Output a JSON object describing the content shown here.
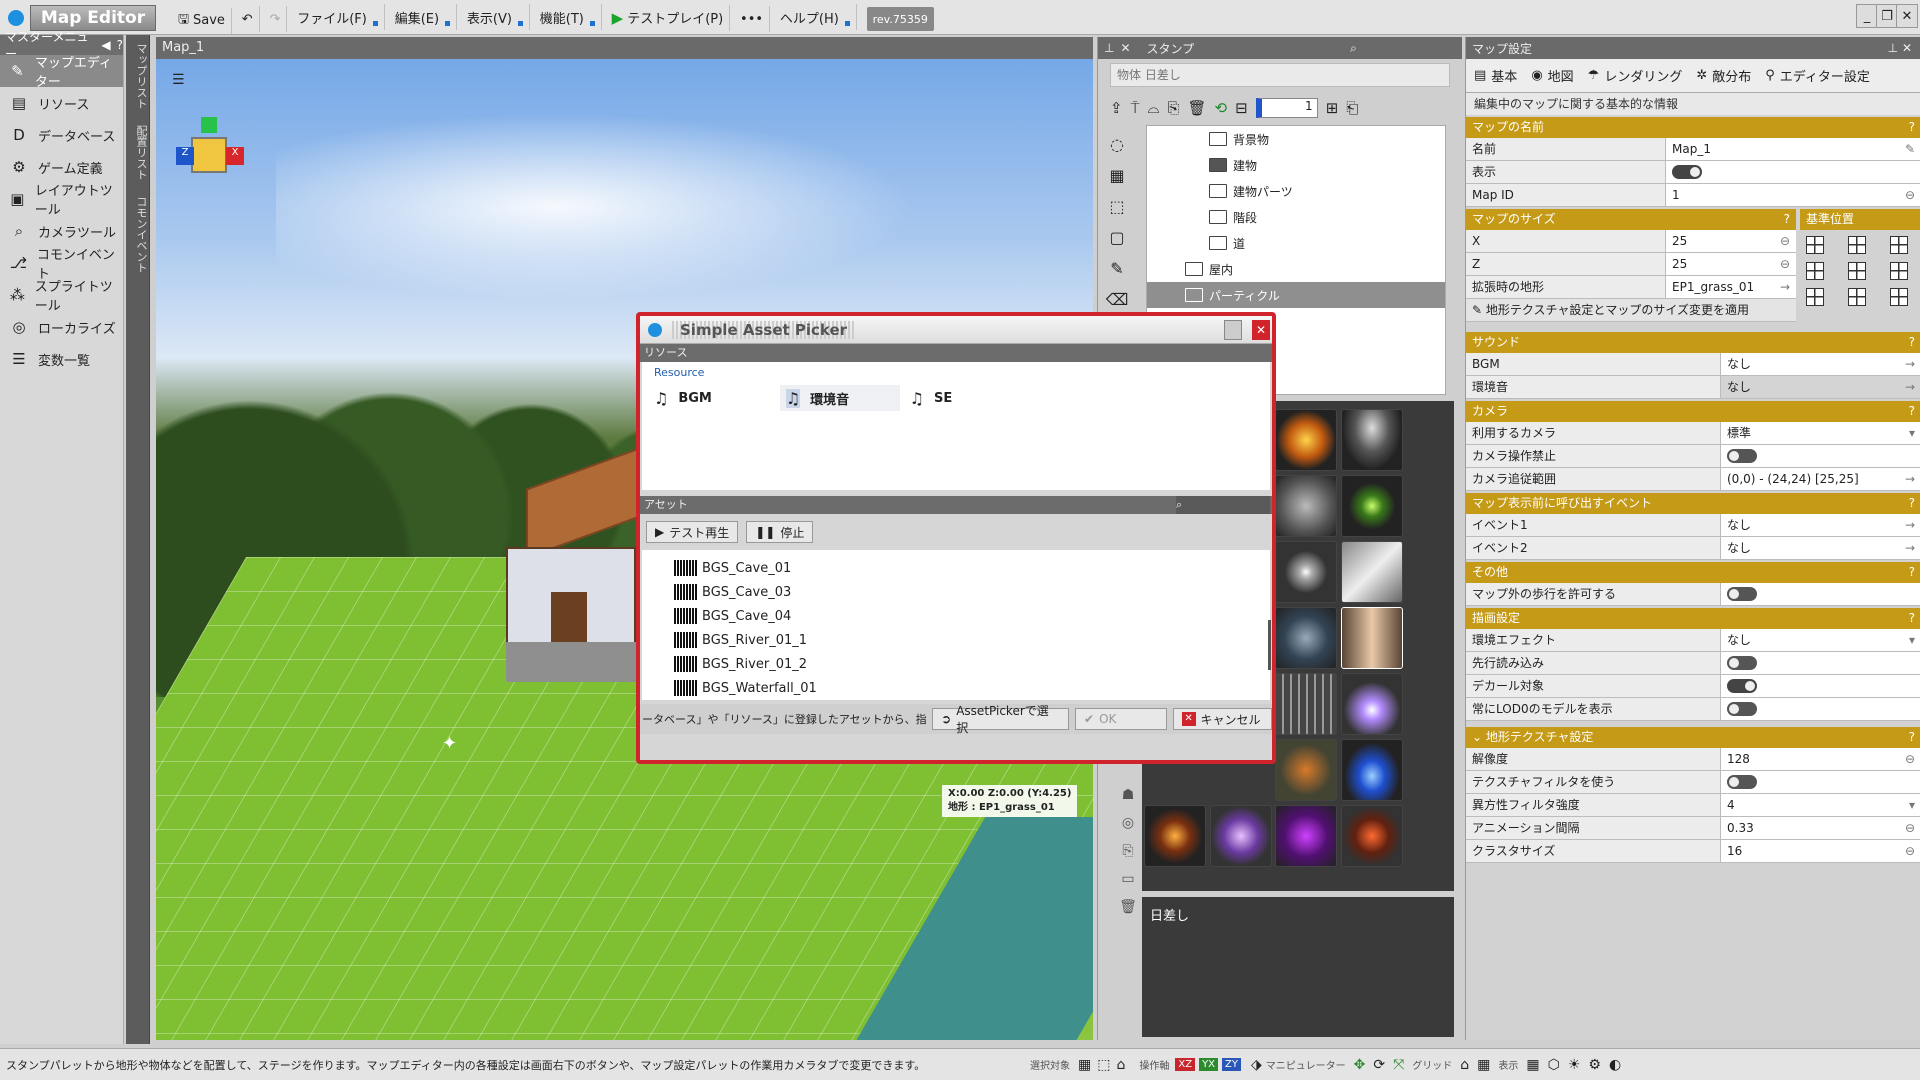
{
  "topbar": {
    "logo": "Map Editor",
    "save": "Save",
    "menus": [
      "ファイル(F)",
      "編集(E)",
      "表示(V)",
      "機能(T)"
    ],
    "testplay": "テストプレイ(P)",
    "more": "•••",
    "help": "ヘルプ(H)",
    "rev": "rev.75359"
  },
  "leftmenu": {
    "title": "マスターメニュー",
    "items": [
      {
        "label": "マップエディター"
      },
      {
        "label": "リソース"
      },
      {
        "label": "データベース"
      },
      {
        "label": "ゲーム定義"
      },
      {
        "label": "レイアウトツール"
      },
      {
        "label": "カメラツール"
      },
      {
        "label": "コモンイベント"
      },
      {
        "label": "スプライトツール"
      },
      {
        "label": "ローカライズ"
      },
      {
        "label": "変数一覧"
      }
    ],
    "strip1": "マップリスト",
    "strip2": "配置リスト",
    "strip3": "コモンイベント"
  },
  "viewport": {
    "tab": "Map_1",
    "coord_line1": "X:0.00 Z:0.00 (Y:4.25)",
    "coord_line2": "地形 : EP1_grass_01"
  },
  "stamp": {
    "title": "スタンプ",
    "search_placeholder": "物体 日差し",
    "count": "1",
    "tree": [
      "背景物",
      "建物",
      "建物パーツ",
      "階段",
      "道",
      "屋内",
      "パーティクル"
    ],
    "selected_name": "日差し"
  },
  "mapset": {
    "title": "マップ設定",
    "tabs": [
      "基本",
      "地図",
      "レンダリング",
      "敵分布",
      "エディター設定"
    ],
    "desc": "編集中のマップに関する基本的な情報",
    "sections": {
      "name": "マップの名前",
      "size": "マップのサイズ",
      "base": "基準位置",
      "sound": "サウンド",
      "camera": "カメラ",
      "events": "マップ表示前に呼び出すイベント",
      "other": "その他",
      "render": "描画設定",
      "terrain": "地形テクスチャ設定"
    },
    "apply": "地形テクスチャ設定とマップのサイズ変更を適用",
    "rows": {
      "name": {
        "k": "名前",
        "v": "Map_1"
      },
      "show": {
        "k": "表示"
      },
      "mapid": {
        "k": "Map ID",
        "v": "1"
      },
      "x": {
        "k": "X",
        "v": "25"
      },
      "z": {
        "k": "Z",
        "v": "25"
      },
      "ext": {
        "k": "拡張時の地形",
        "v": "EP1_grass_01"
      },
      "bgm": {
        "k": "BGM",
        "v": "なし"
      },
      "env": {
        "k": "環境音",
        "v": "なし"
      },
      "cam": {
        "k": "利用するカメラ",
        "v": "標準"
      },
      "camlock": {
        "k": "カメラ操作禁止"
      },
      "camrange": {
        "k": "カメラ追従範囲",
        "v": "(0,0) - (24,24) [25,25]"
      },
      "ev1": {
        "k": "イベント1",
        "v": "なし"
      },
      "ev2": {
        "k": "イベント2",
        "v": "なし"
      },
      "walk": {
        "k": "マップ外の歩行を許可する"
      },
      "effect": {
        "k": "環境エフェクト",
        "v": "なし"
      },
      "preload": {
        "k": "先行読み込み"
      },
      "decal": {
        "k": "デカール対象"
      },
      "lod": {
        "k": "常にLOD0のモデルを表示"
      },
      "res": {
        "k": "解像度",
        "v": "128"
      },
      "texfilter": {
        "k": "テクスチャフィルタを使う"
      },
      "aniso": {
        "k": "異方性フィルタ強度",
        "v": "4"
      },
      "anim": {
        "k": "アニメーション間隔",
        "v": "0.33"
      },
      "cluster": {
        "k": "クラスタサイズ",
        "v": "16"
      }
    }
  },
  "dialog": {
    "title": "Simple Asset Picker",
    "res_header": "リソース",
    "res_label": "Resource",
    "res_items": [
      "BGM",
      "環境音",
      "SE"
    ],
    "asset_header": "アセット",
    "play": "テスト再生",
    "stop": "停止",
    "assets": [
      "BGS_Cave_01",
      "BGS_Cave_03",
      "BGS_Cave_04",
      "BGS_River_01_1",
      "BGS_River_01_2",
      "BGS_Waterfall_01"
    ],
    "footer_hint": "ータベース」や「リソース」に登録したアセットから、指定の",
    "select_btn": "AssetPickerで選択",
    "ok": "OK",
    "cancel": "キャンセル"
  },
  "statusbar": {
    "hint": "スタンプパレットから地形や物体などを配置して、ステージを作ります。マップエディター内の各種設定は画面右下のボタンや、マップ設定パレットの作業用カメラタブで変更できます。",
    "sel": "選択対象",
    "op": "操作軸",
    "axes": [
      "XZ",
      "YX",
      "ZY"
    ],
    "manip": "マニピュレーター",
    "grid": "グリッド",
    "view": "表示"
  }
}
